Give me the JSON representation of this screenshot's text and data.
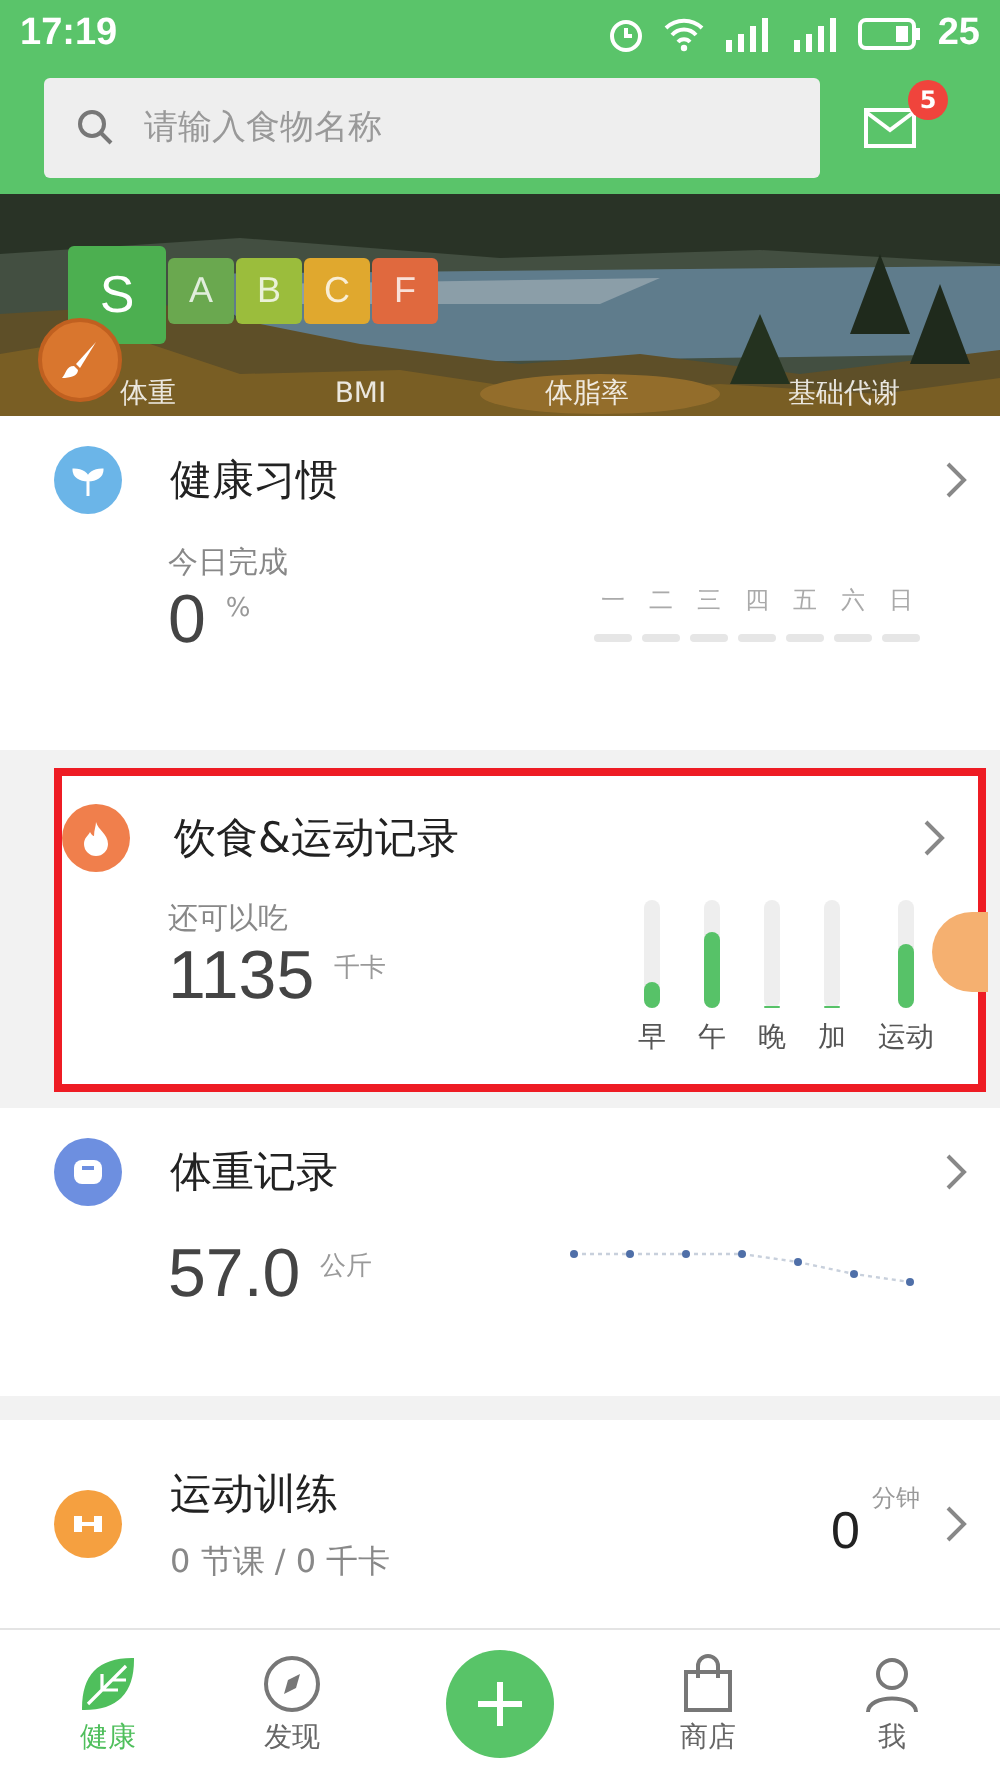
{
  "status_bar": {
    "time": "17:19",
    "battery": "25"
  },
  "search": {
    "placeholder": "请输入食物名称"
  },
  "messages": {
    "badge": "5"
  },
  "banner": {
    "grades": [
      {
        "label": "S",
        "selected": true,
        "color": "#4caf50"
      },
      {
        "label": "A",
        "selected": false,
        "color": "#6aa84f"
      },
      {
        "label": "B",
        "selected": false,
        "color": "#9bbd3c"
      },
      {
        "label": "C",
        "selected": false,
        "color": "#e0a82e"
      },
      {
        "label": "F",
        "selected": false,
        "color": "#e0693e"
      }
    ],
    "metrics": [
      "体重",
      "BMI",
      "体脂率",
      "基础代谢"
    ]
  },
  "habits": {
    "title": "健康习惯",
    "caption": "今日完成",
    "value": "0",
    "unit": "%",
    "days": [
      "一",
      "二",
      "三",
      "四",
      "五",
      "六",
      "日"
    ]
  },
  "diet": {
    "title": "饮食&运动记录",
    "highlighted": true,
    "caption": "还可以吃",
    "value": "1135",
    "unit": "千卡",
    "meals": [
      {
        "label": "早",
        "level": 0.25
      },
      {
        "label": "午",
        "level": 0.7
      },
      {
        "label": "晚",
        "level": 0
      },
      {
        "label": "加",
        "level": 0
      },
      {
        "label": "运动",
        "level": 0.6
      }
    ]
  },
  "weight": {
    "title": "体重记录",
    "value": "57.0",
    "unit": "公斤"
  },
  "training": {
    "title": "运动训练",
    "summary": "0 节课 / 0 千卡",
    "value": "0",
    "unit": "分钟"
  },
  "tab_bar": [
    {
      "label": "健康",
      "kind": "leaf",
      "selected": true
    },
    {
      "label": "发现",
      "kind": "compass",
      "selected": false
    },
    {
      "kind": "add",
      "selected": false
    },
    {
      "label": "商店",
      "kind": "bag",
      "selected": false
    },
    {
      "label": "我",
      "kind": "person",
      "selected": false
    }
  ]
}
